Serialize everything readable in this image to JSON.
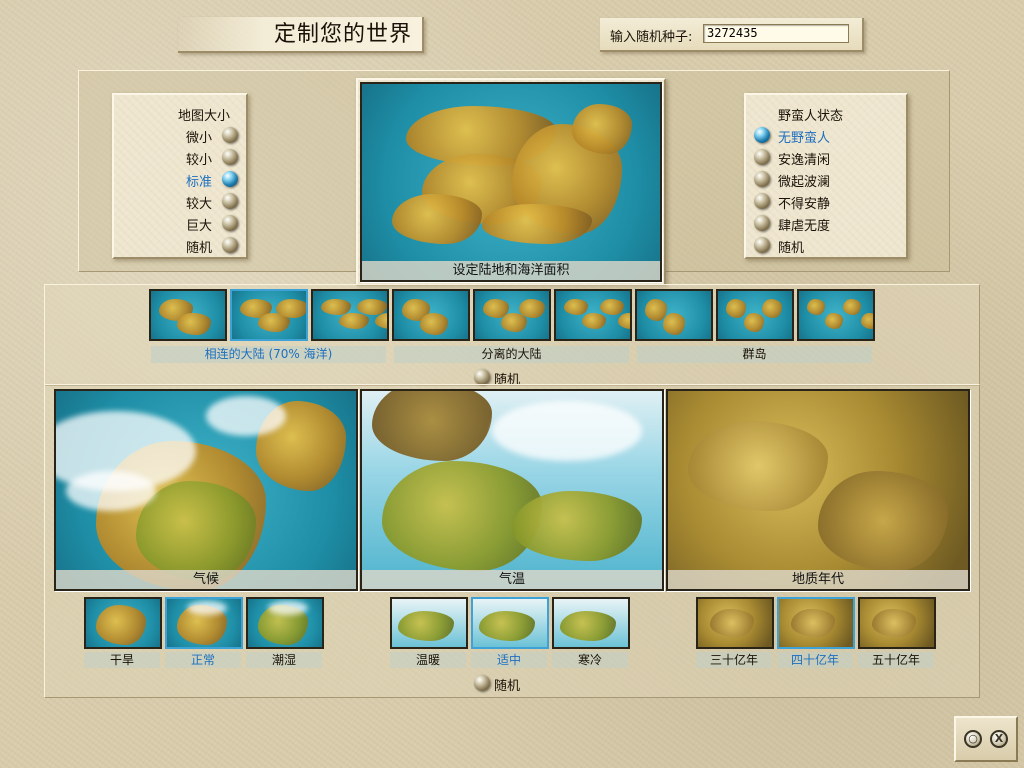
{
  "title": "定制您的世界",
  "seed": {
    "label": "输入随机种子:",
    "value": "3272435"
  },
  "map_size": {
    "heading": "地图大小",
    "options": [
      {
        "label": "微小",
        "selected": false
      },
      {
        "label": "较小",
        "selected": false
      },
      {
        "label": "标准",
        "selected": true
      },
      {
        "label": "较大",
        "selected": false
      },
      {
        "label": "巨大",
        "selected": false
      },
      {
        "label": "随机",
        "selected": false
      }
    ]
  },
  "barbarians": {
    "heading": "野蛮人状态",
    "options": [
      {
        "label": "无野蛮人",
        "selected": true
      },
      {
        "label": "安逸清闲",
        "selected": false
      },
      {
        "label": "微起波澜",
        "selected": false
      },
      {
        "label": "不得安静",
        "selected": false
      },
      {
        "label": "肆虐无度",
        "selected": false
      },
      {
        "label": "随机",
        "selected": false
      }
    ]
  },
  "land_water": {
    "caption": "设定陆地和海洋面积",
    "groups": [
      {
        "label": "相连的大陆 (70% 海洋)",
        "selected": true
      },
      {
        "label": "分离的大陆",
        "selected": false
      },
      {
        "label": "群岛",
        "selected": false
      }
    ],
    "thumb_count": 9,
    "selected_thumb": 1,
    "random_label": "随机"
  },
  "climate": {
    "caption": "气候",
    "options": [
      {
        "label": "干旱",
        "selected": false
      },
      {
        "label": "正常",
        "selected": true
      },
      {
        "label": "潮湿",
        "selected": false
      }
    ]
  },
  "temperature": {
    "caption": "气温",
    "options": [
      {
        "label": "温暖",
        "selected": false
      },
      {
        "label": "适中",
        "selected": true
      },
      {
        "label": "寒冷",
        "selected": false
      }
    ]
  },
  "age": {
    "caption": "地质年代",
    "options": [
      {
        "label": "三十亿年",
        "selected": false
      },
      {
        "label": "四十亿年",
        "selected": true
      },
      {
        "label": "五十亿年",
        "selected": false
      }
    ]
  },
  "bottom_random_label": "随机",
  "colors": {
    "selected_text": "#1d6fc0",
    "ocean": "#1e8ea6",
    "land": "#c89a30",
    "parchment": "#efe6cf"
  },
  "icons": {
    "ok": "ok-icon",
    "close": "close-icon"
  }
}
